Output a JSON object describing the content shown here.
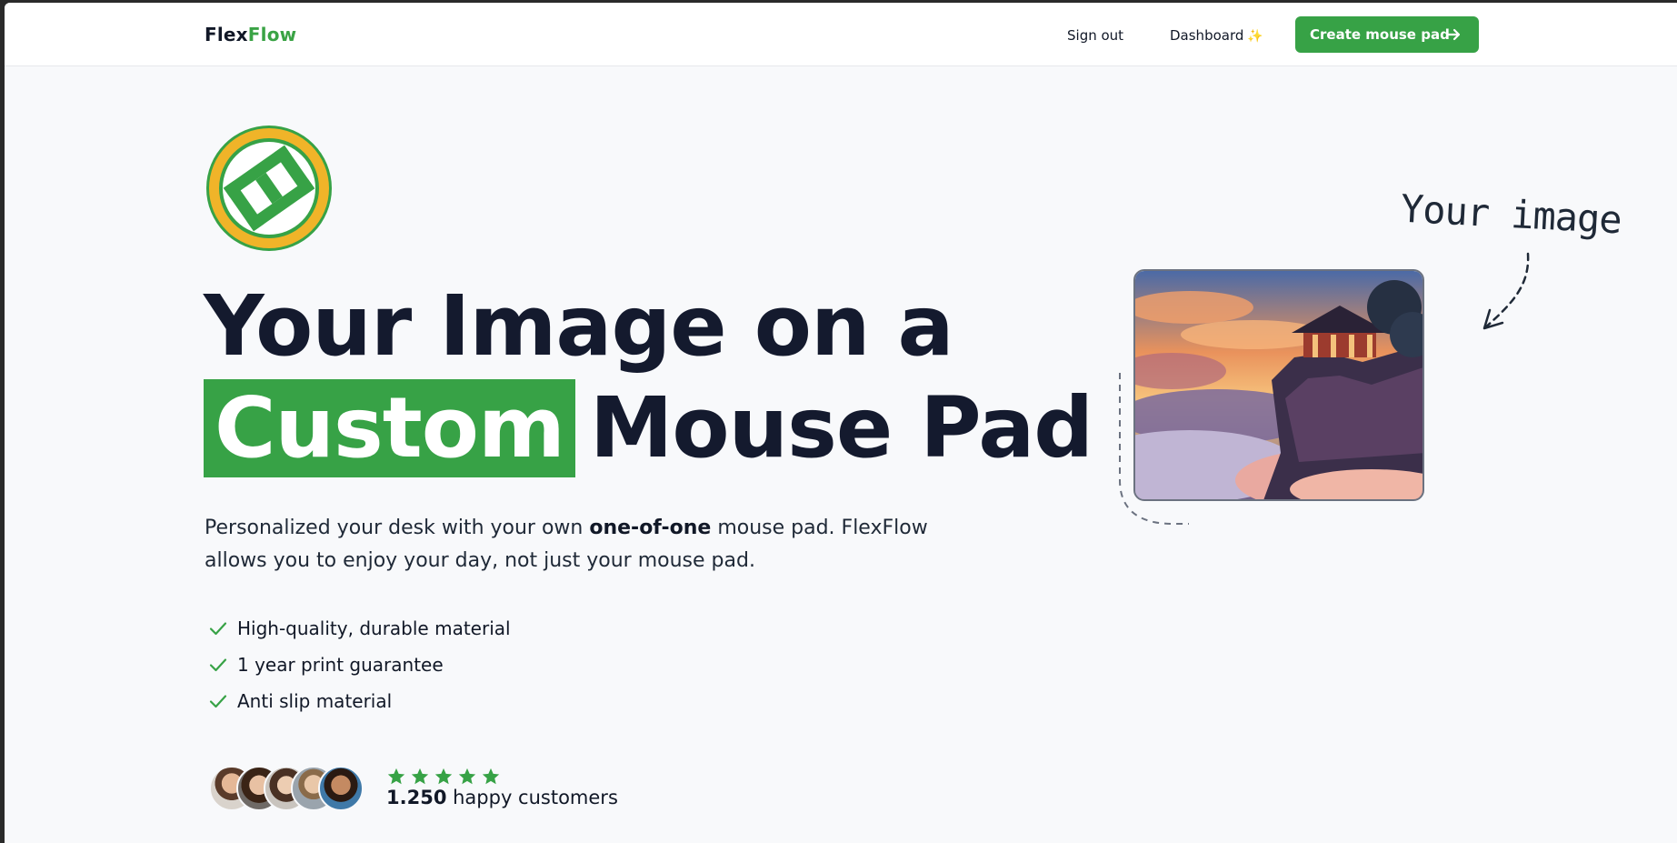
{
  "nav": {
    "brand_part1": "Flex",
    "brand_part2": "Flow",
    "sign_out": "Sign out",
    "dashboard": "Dashboard",
    "dashboard_icon": "sparkles-icon",
    "cta": "Create mouse pad",
    "cta_icon": "arrow-right-icon"
  },
  "hero": {
    "headline_line1": "Your Image on a",
    "headline_highlight": "Custom",
    "headline_line2_rest": "Mouse Pad",
    "sub_before": "Personalized your desk with your own ",
    "sub_bold": "one-of-one",
    "sub_after": " mouse pad. FlexFlow allows you to enjoy your day, not just your mouse pad.",
    "features": [
      "High-quality, durable material",
      "1 year print guarantee",
      "Anti slip material"
    ],
    "customers_count": "1.250",
    "customers_label": " happy customers",
    "rating_stars": 5
  },
  "showcase": {
    "annotation": "Your image"
  },
  "colors": {
    "accent": "#37a246",
    "logo_ring": "#f0b429",
    "text_dark": "#141a2e"
  }
}
